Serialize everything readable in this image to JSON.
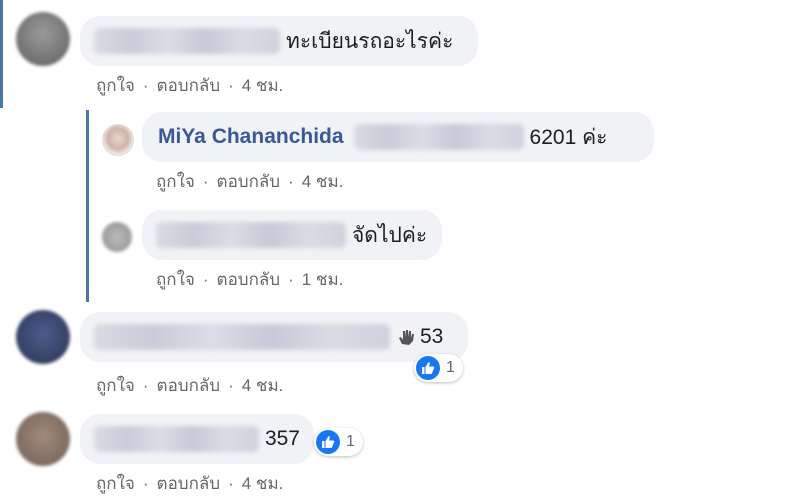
{
  "comments": [
    {
      "text": "ทะเบียนรถอะไรค่ะ",
      "like": "ถูกใจ",
      "reply": "ตอบกลับ",
      "time": "4 ชม."
    },
    {
      "name": "MiYa Chananchida",
      "text": "6201 ค่ะ",
      "like": "ถูกใจ",
      "reply": "ตอบกลับ",
      "time": "4 ชม."
    },
    {
      "text": "จัดไปค่ะ",
      "like": "ถูกใจ",
      "reply": "ตอบกลับ",
      "time": "1 ชม."
    },
    {
      "text": "53",
      "icon": "wave-hand-icon",
      "like": "ถูกใจ",
      "reply": "ตอบกลับ",
      "time": "4 ชม.",
      "reactions": "1"
    },
    {
      "text": "357",
      "like": "ถูกใจ",
      "reply": "ตอบกลับ",
      "time": "4 ชม.",
      "reactions": "1"
    }
  ],
  "colors": {
    "bubble": "#f0f2f5",
    "name": "#385898",
    "like": "#1877f2",
    "thread": "#4a76a8"
  }
}
